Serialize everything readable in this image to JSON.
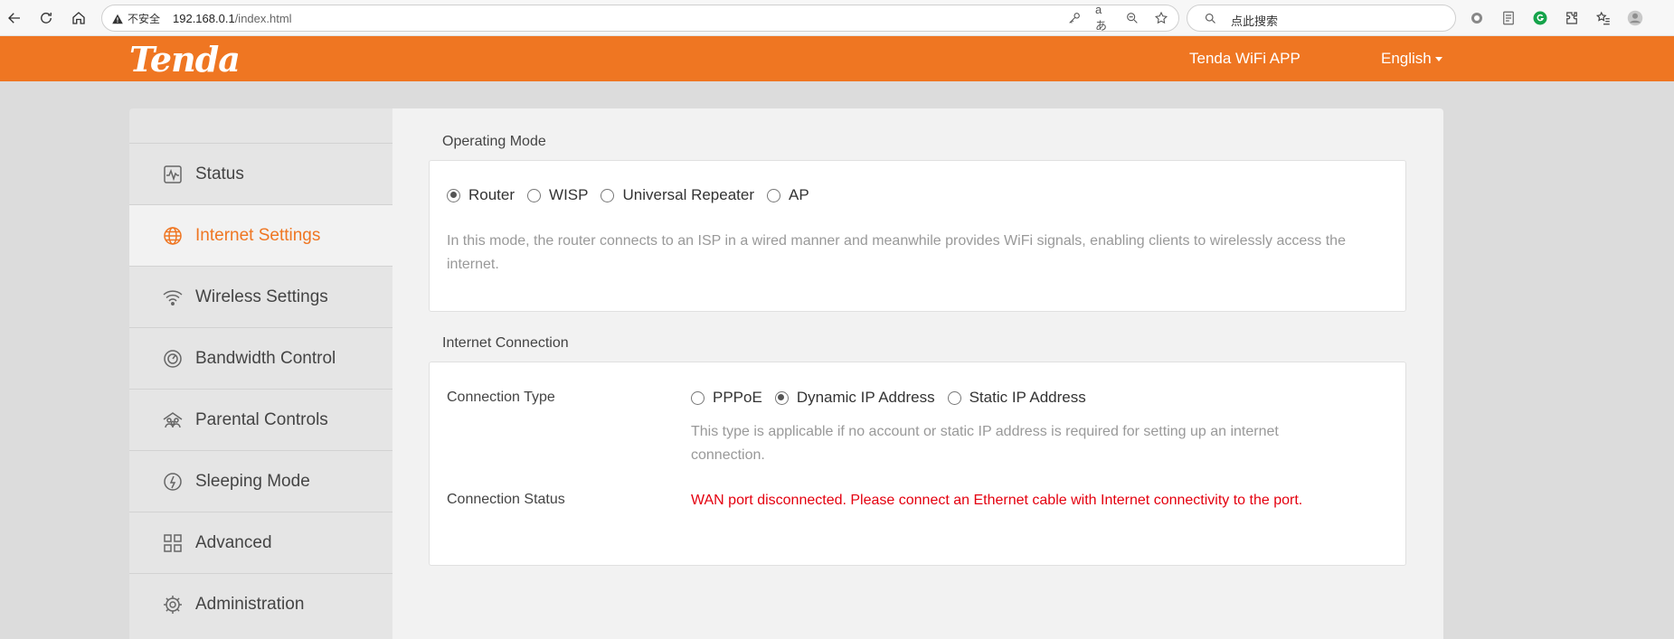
{
  "browser": {
    "insecure_label": "不安全",
    "url_host": "192.168.0.1",
    "url_path": "/index.html",
    "search_placeholder": "点此搜索",
    "translate_glyph": "aあ"
  },
  "header": {
    "logo": "Tenda",
    "app_link": "Tenda WiFi APP",
    "language": "English",
    "brand_color": "#ef7622"
  },
  "sidebar": {
    "items": [
      {
        "label": "Status",
        "icon": "status-icon"
      },
      {
        "label": "Internet Settings",
        "icon": "globe-icon",
        "active": true
      },
      {
        "label": "Wireless Settings",
        "icon": "wifi-icon"
      },
      {
        "label": "Bandwidth Control",
        "icon": "gauge-icon"
      },
      {
        "label": "Parental Controls",
        "icon": "family-icon"
      },
      {
        "label": "Sleeping Mode",
        "icon": "sleep-icon"
      },
      {
        "label": "Advanced",
        "icon": "grid-icon"
      },
      {
        "label": "Administration",
        "icon": "gear-icon"
      }
    ]
  },
  "operating_mode": {
    "title": "Operating Mode",
    "options": [
      "Router",
      "WISP",
      "Universal Repeater",
      "AP"
    ],
    "selected": "Router",
    "description": "In this mode, the router connects to an ISP in a wired manner and meanwhile provides WiFi signals, enabling clients to wirelessly access the internet."
  },
  "internet_connection": {
    "title": "Internet Connection",
    "connection_type_label": "Connection Type",
    "options": [
      "PPPoE",
      "Dynamic IP Address",
      "Static IP Address"
    ],
    "selected": "Dynamic IP Address",
    "type_description": "This type is applicable if no account or static IP address is required for setting up an internet connection.",
    "status_label": "Connection Status",
    "status_text": "WAN port disconnected. Please connect an Ethernet cable with Internet connectivity to the port.",
    "error_color": "#e4000f"
  }
}
